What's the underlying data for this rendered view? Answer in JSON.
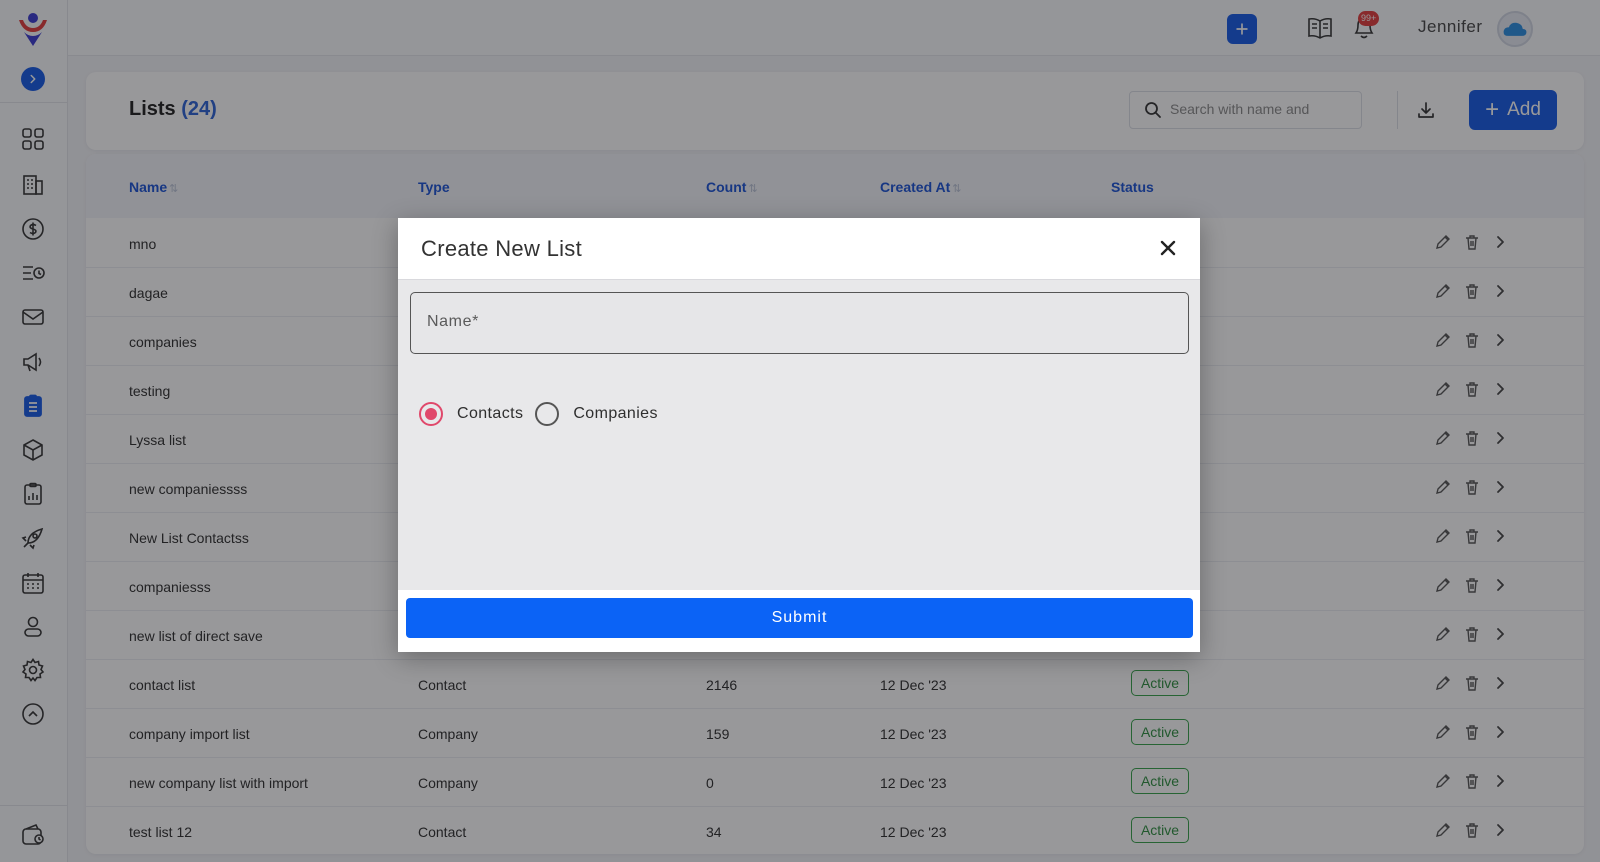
{
  "topbar": {
    "user_name": "Jennifer",
    "notification_badge": "99+"
  },
  "header": {
    "title": "Lists",
    "count": "(24)",
    "search_placeholder": "Search with name and",
    "add_label": "Add"
  },
  "table": {
    "columns": [
      "Name",
      "Type",
      "Count",
      "Created At",
      "Status"
    ],
    "rows": [
      {
        "name": "mno",
        "type": "",
        "count": "",
        "created": "",
        "status": ""
      },
      {
        "name": "dagae",
        "type": "",
        "count": "",
        "created": "",
        "status": ""
      },
      {
        "name": "companies",
        "type": "",
        "count": "",
        "created": "",
        "status": ""
      },
      {
        "name": "testing",
        "type": "",
        "count": "",
        "created": "",
        "status": ""
      },
      {
        "name": "Lyssa list",
        "type": "",
        "count": "",
        "created": "",
        "status": ""
      },
      {
        "name": "new companiessss",
        "type": "",
        "count": "",
        "created": "",
        "status": ""
      },
      {
        "name": "New List Contactss",
        "type": "",
        "count": "",
        "created": "",
        "status": ""
      },
      {
        "name": "companiesss",
        "type": "",
        "count": "",
        "created": "",
        "status": ""
      },
      {
        "name": "new list of direct save",
        "type": "",
        "count": "",
        "created": "",
        "status": ""
      },
      {
        "name": "contact list",
        "type": "Contact",
        "count": "2146",
        "created": "12 Dec '23",
        "status": "Active"
      },
      {
        "name": "company import list",
        "type": "Company",
        "count": "159",
        "created": "12 Dec '23",
        "status": "Active"
      },
      {
        "name": "new company list with import",
        "type": "Company",
        "count": "0",
        "created": "12 Dec '23",
        "status": "Active"
      },
      {
        "name": "test list 12",
        "type": "Contact",
        "count": "34",
        "created": "12 Dec '23",
        "status": "Active"
      }
    ]
  },
  "modal": {
    "title": "Create New List",
    "name_placeholder": "Name*",
    "name_value": "",
    "options": [
      "Contacts",
      "Companies"
    ],
    "selected": "Contacts",
    "submit_label": "Submit"
  },
  "sidebar": {
    "icons": [
      "dashboard-icon",
      "building-icon",
      "dollar-icon",
      "filter-list-icon",
      "mail-icon",
      "megaphone-icon",
      "list-icon",
      "box-icon",
      "clipboard-chart-icon",
      "rocket-icon",
      "calendar-icon",
      "user-icon",
      "settings-icon",
      "chevron-up-circle-icon",
      "wallet-icon"
    ],
    "active": "list-icon"
  },
  "colors": {
    "primary": "#1559e6",
    "link": "#1a52d6",
    "active_status": "#37a24a",
    "radio_selected": "#e0486b",
    "badge": "#e23b3b"
  }
}
